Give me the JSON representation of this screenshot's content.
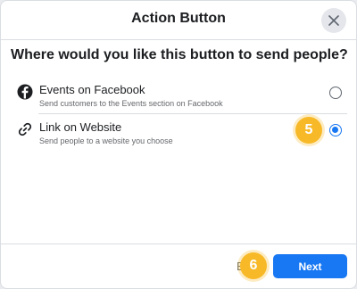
{
  "dialog": {
    "title": "Action Button",
    "question": "Where would you like this button to send people?"
  },
  "options": [
    {
      "title": "Events on Facebook",
      "subtitle": "Send customers to the Events section on Facebook",
      "icon": "facebook-icon",
      "selected": false
    },
    {
      "title": "Link on Website",
      "subtitle": "Send people to a website you choose",
      "icon": "link-icon",
      "selected": true
    }
  ],
  "badges": {
    "step5": "5",
    "step6": "6"
  },
  "footer": {
    "back_partial": "B",
    "next_label": "Next"
  },
  "colors": {
    "accent": "#1877f2",
    "badge": "#f7b928"
  }
}
